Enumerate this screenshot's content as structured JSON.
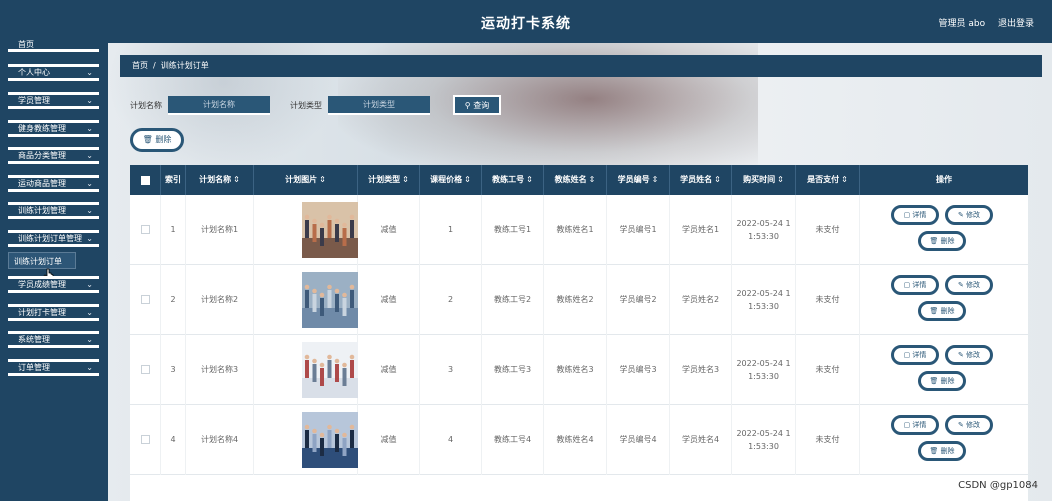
{
  "app": {
    "title": "运动打卡系统",
    "user": "管理员 abo",
    "logout": "退出登录"
  },
  "sidebar": {
    "items": [
      {
        "label": "首页"
      },
      {
        "label": "个人中心"
      },
      {
        "label": "学员管理"
      },
      {
        "label": "健身教练管理"
      },
      {
        "label": "商品分类管理"
      },
      {
        "label": "运动商品管理"
      },
      {
        "label": "训练计划管理"
      },
      {
        "label": "训练计划订单管理"
      },
      {
        "label": "学员成绩管理"
      },
      {
        "label": "计划打卡管理"
      },
      {
        "label": "系统管理"
      },
      {
        "label": "订单管理"
      }
    ],
    "active_sub": "训练计划订单"
  },
  "breadcrumb": {
    "home": "首页",
    "sep": "/",
    "current": "训练计划订单"
  },
  "search": {
    "name_label": "计划名称",
    "name_placeholder": "计划名称",
    "type_label": "计划类型",
    "type_placeholder": "计划类型",
    "query_label": "查询"
  },
  "delete_label": "删除",
  "table": {
    "columns": [
      "索引",
      "计划名称",
      "计划图片",
      "计划类型",
      "课程价格",
      "教练工号",
      "教练姓名",
      "学员编号",
      "学员姓名",
      "购买时间",
      "是否支付",
      "操作"
    ],
    "rows": [
      {
        "index": "1",
        "name": "计划名称1",
        "type": "减值",
        "price": "1",
        "coach_no": "教练工号1",
        "coach_name": "教练姓名1",
        "student_no": "学员编号1",
        "student_name": "学员姓名1",
        "time_a": "2022-05-24 1",
        "time_b": "1:53:30",
        "paid": "未支付"
      },
      {
        "index": "2",
        "name": "计划名称2",
        "type": "减值",
        "price": "2",
        "coach_no": "教练工号2",
        "coach_name": "教练姓名2",
        "student_no": "学员编号2",
        "student_name": "学员姓名2",
        "time_a": "2022-05-24 1",
        "time_b": "1:53:30",
        "paid": "未支付"
      },
      {
        "index": "3",
        "name": "计划名称3",
        "type": "减值",
        "price": "3",
        "coach_no": "教练工号3",
        "coach_name": "教练姓名3",
        "student_no": "学员编号3",
        "student_name": "学员姓名3",
        "time_a": "2022-05-24 1",
        "time_b": "1:53:30",
        "paid": "未支付"
      },
      {
        "index": "4",
        "name": "计划名称4",
        "type": "减值",
        "price": "4",
        "coach_no": "教练工号4",
        "coach_name": "教练姓名4",
        "student_no": "学员编号4",
        "student_name": "学员姓名4",
        "time_a": "2022-05-24 1",
        "time_b": "1:53:30",
        "paid": "未支付"
      }
    ],
    "op_detail": "详情",
    "op_edit": "修改",
    "op_delete": "删除"
  },
  "watermark": "CSDN @gp1084",
  "icons": {
    "sort": "sort-icon",
    "chevron": "chevron-down-icon",
    "search": "search-icon",
    "trash": "trash-icon",
    "detail": "detail-icon",
    "edit": "edit-icon",
    "cursor": "cursor-icon"
  },
  "colors": {
    "primary": "#1f4563",
    "accent": "#2a5777",
    "row_bg": "#ffffff"
  }
}
